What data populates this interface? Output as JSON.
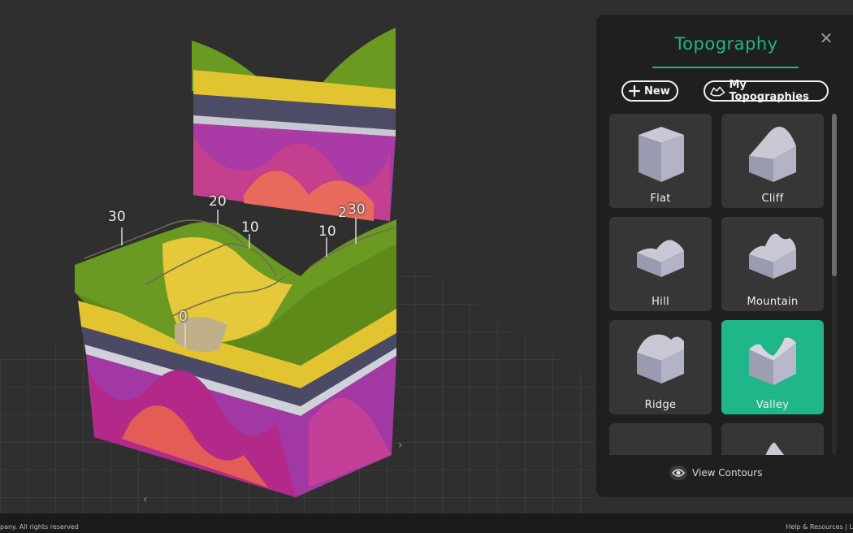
{
  "scene": {
    "contour_labels": [
      {
        "id": "contour-30-left",
        "text": "30"
      },
      {
        "id": "contour-20",
        "text": "20"
      },
      {
        "id": "contour-10-left",
        "text": "10"
      },
      {
        "id": "contour-0",
        "text": "0"
      },
      {
        "id": "contour-10-right",
        "text": "10"
      },
      {
        "id": "contour-2-partial",
        "text": "2"
      },
      {
        "id": "contour-30-right",
        "text": "30"
      }
    ]
  },
  "panel": {
    "title": "Topography",
    "new_label": "New",
    "my_topographies_label": "My Topographies",
    "cards": [
      {
        "label": "Flat",
        "icon": "flat-terrain-icon",
        "selected": false
      },
      {
        "label": "Cliff",
        "icon": "cliff-terrain-icon",
        "selected": false
      },
      {
        "label": "Hill",
        "icon": "hill-terrain-icon",
        "selected": false
      },
      {
        "label": "Mountain",
        "icon": "mountain-terrain-icon",
        "selected": false
      },
      {
        "label": "Ridge",
        "icon": "ridge-terrain-icon",
        "selected": false
      },
      {
        "label": "Valley",
        "icon": "valley-terrain-icon",
        "selected": true
      }
    ],
    "view_contours_label": "View Contours"
  },
  "colors": {
    "accent": "#1fb68a",
    "panel_bg": "#1f1f1f",
    "card_bg": "#363636"
  },
  "footer": {
    "left_text": "pany. All rights reserved",
    "right_text": "Help & Resources | L"
  }
}
